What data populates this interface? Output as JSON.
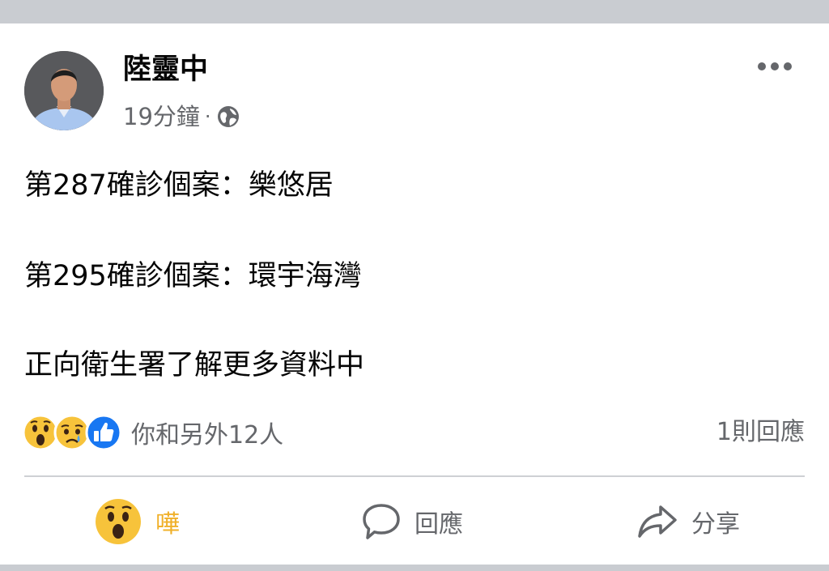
{
  "post": {
    "author": "陸靈中",
    "time": "19分鐘",
    "separator": "·",
    "privacy_icon": "globe-icon",
    "more_icon": "more-horizontal-icon",
    "lines": [
      "第287確診個案：樂悠居",
      "第295確診個案：環宇海灣",
      "正向衛生署了解更多資料中"
    ]
  },
  "reactions": {
    "icons": [
      "wow-reaction-icon",
      "sad-reaction-icon",
      "like-reaction-icon"
    ],
    "summary": "你和另外12人",
    "comments": "1則回應"
  },
  "actions": {
    "wow": {
      "label": "嘩",
      "icon": "wow-reaction-icon"
    },
    "comment": {
      "label": "回應",
      "icon": "comment-icon"
    },
    "share": {
      "label": "分享",
      "icon": "share-icon"
    }
  },
  "colors": {
    "secondary_text": "#65676b",
    "wow_active": "#f0b029",
    "like_blue": "#1877f2",
    "divider": "#ced0d4",
    "frame_gray": "#c9ccd1"
  }
}
